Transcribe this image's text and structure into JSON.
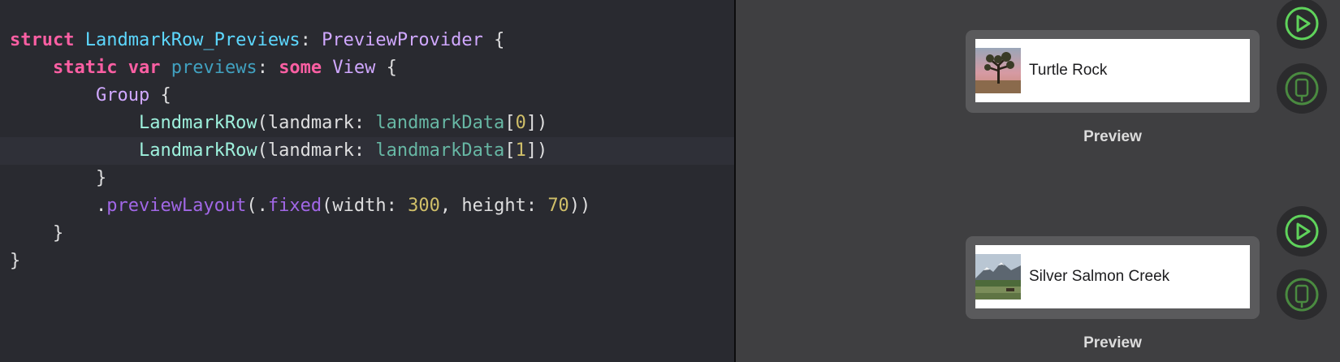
{
  "editor": {
    "lines": [
      {
        "tokens": [
          {
            "text": "struct",
            "cls": "t-kw"
          },
          {
            "text": " ",
            "cls": "t-plain"
          },
          {
            "text": "LandmarkRow_Previews",
            "cls": "t-decl"
          },
          {
            "text": ": ",
            "cls": "t-plain"
          },
          {
            "text": "PreviewProvider",
            "cls": "t-type"
          },
          {
            "text": " {",
            "cls": "t-plain"
          }
        ]
      },
      {
        "tokens": [
          {
            "text": "    ",
            "cls": "t-plain"
          },
          {
            "text": "static",
            "cls": "t-kw"
          },
          {
            "text": " ",
            "cls": "t-plain"
          },
          {
            "text": "var",
            "cls": "t-kw"
          },
          {
            "text": " ",
            "cls": "t-plain"
          },
          {
            "text": "previews",
            "cls": "t-prop"
          },
          {
            "text": ": ",
            "cls": "t-plain"
          },
          {
            "text": "some",
            "cls": "t-kw"
          },
          {
            "text": " ",
            "cls": "t-plain"
          },
          {
            "text": "View",
            "cls": "t-type"
          },
          {
            "text": " {",
            "cls": "t-plain"
          }
        ]
      },
      {
        "tokens": [
          {
            "text": "        ",
            "cls": "t-plain"
          },
          {
            "text": "Group",
            "cls": "t-type"
          },
          {
            "text": " {",
            "cls": "t-plain"
          }
        ]
      },
      {
        "tokens": [
          {
            "text": "            ",
            "cls": "t-plain"
          },
          {
            "text": "LandmarkRow",
            "cls": "t-ptype"
          },
          {
            "text": "(landmark: ",
            "cls": "t-plain"
          },
          {
            "text": "landmarkData",
            "cls": "t-pvar"
          },
          {
            "text": "[",
            "cls": "t-plain"
          },
          {
            "text": "0",
            "cls": "t-num"
          },
          {
            "text": "])",
            "cls": "t-plain"
          }
        ]
      },
      {
        "highlighted": true,
        "tokens": [
          {
            "text": "            ",
            "cls": "t-plain"
          },
          {
            "text": "LandmarkRow",
            "cls": "t-ptype"
          },
          {
            "text": "(landmark: ",
            "cls": "t-plain"
          },
          {
            "text": "landmarkData",
            "cls": "t-pvar"
          },
          {
            "text": "[",
            "cls": "t-plain"
          },
          {
            "text": "1",
            "cls": "t-num"
          },
          {
            "text": "])",
            "cls": "t-plain"
          }
        ]
      },
      {
        "tokens": [
          {
            "text": "        }",
            "cls": "t-plain"
          }
        ]
      },
      {
        "tokens": [
          {
            "text": "        .",
            "cls": "t-plain"
          },
          {
            "text": "previewLayout",
            "cls": "t-meth"
          },
          {
            "text": "(.",
            "cls": "t-plain"
          },
          {
            "text": "fixed",
            "cls": "t-meth"
          },
          {
            "text": "(width: ",
            "cls": "t-plain"
          },
          {
            "text": "300",
            "cls": "t-num"
          },
          {
            "text": ", height: ",
            "cls": "t-plain"
          },
          {
            "text": "70",
            "cls": "t-num"
          },
          {
            "text": "))",
            "cls": "t-plain"
          }
        ]
      },
      {
        "tokens": [
          {
            "text": "    }",
            "cls": "t-plain"
          }
        ]
      },
      {
        "tokens": [
          {
            "text": "}",
            "cls": "t-plain"
          }
        ]
      }
    ]
  },
  "canvas": {
    "previews": [
      {
        "row_title": "Turtle Rock",
        "label": "Preview",
        "thumb_icon": "turtle-rock-thumbnail"
      },
      {
        "row_title": "Silver Salmon Creek",
        "label": "Preview",
        "thumb_icon": "silver-salmon-creek-thumbnail"
      }
    ],
    "buttons": {
      "live_icon": "play-icon",
      "device_icon": "device-icon"
    }
  },
  "colors": {
    "editor_bg": "#292a30",
    "canvas_bg": "#3f3f41",
    "accent_green": "#5fd35b",
    "keyword": "#fc5fa3",
    "type": "#d0a8ff"
  }
}
